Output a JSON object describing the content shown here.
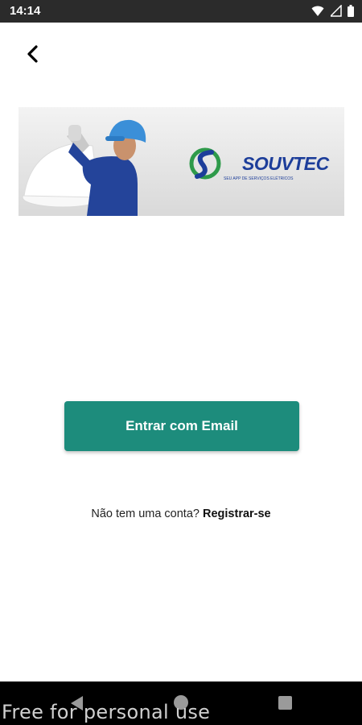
{
  "status_bar": {
    "time": "14:14",
    "icons": [
      "wifi-icon",
      "signal-icon",
      "battery-icon"
    ]
  },
  "header": {
    "back_icon": "back-arrow-icon"
  },
  "banner": {
    "brand_name": "SOUVTEC",
    "tagline": "SEU APP DE SERVIÇOS ELÉTRICOS"
  },
  "main": {
    "email_login_label": "Entrar com Email",
    "register_prompt": "Não tem uma conta?",
    "register_link": "Registrar-se"
  },
  "nav_bar": {
    "icons": [
      "nav-back-icon",
      "nav-home-icon",
      "nav-recents-icon"
    ]
  },
  "watermark": "Free for personal use",
  "colors": {
    "primary": "#1d8c7c",
    "status_bar": "#2b2b2b",
    "nav_bar": "#000000",
    "logo_blue": "#1d3e9a",
    "logo_green": "#2e9a4a"
  }
}
